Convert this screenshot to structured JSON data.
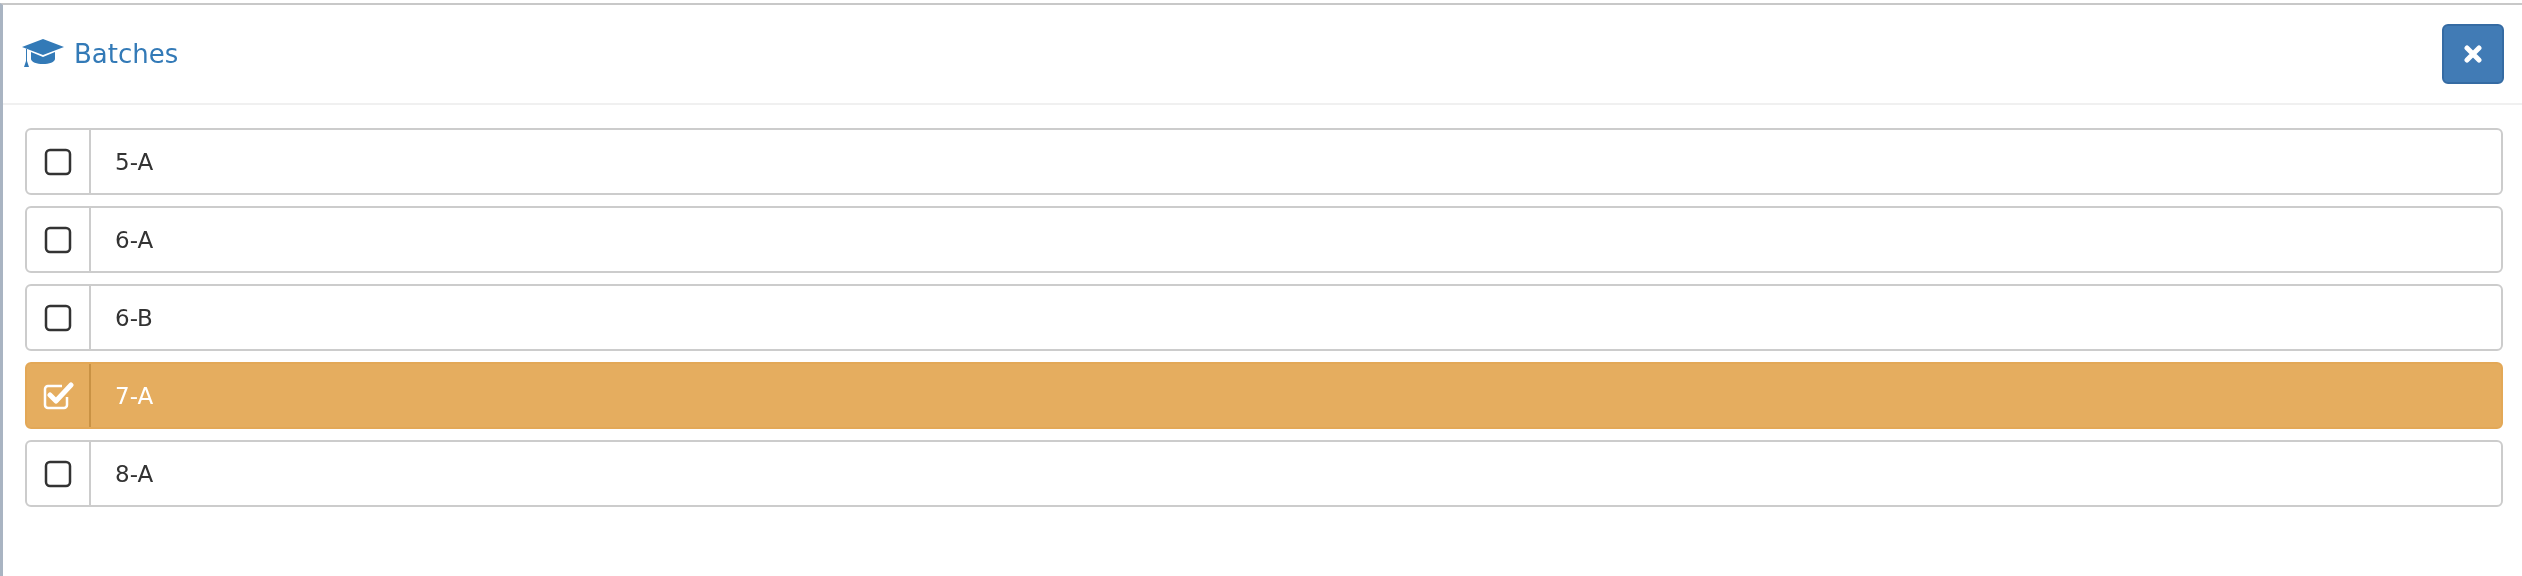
{
  "dialog": {
    "title": "Batches"
  },
  "batches": [
    {
      "label": "5-A",
      "checked": false
    },
    {
      "label": "6-A",
      "checked": false
    },
    {
      "label": "6-B",
      "checked": false
    },
    {
      "label": "7-A",
      "checked": true
    },
    {
      "label": "8-A",
      "checked": false
    }
  ]
}
